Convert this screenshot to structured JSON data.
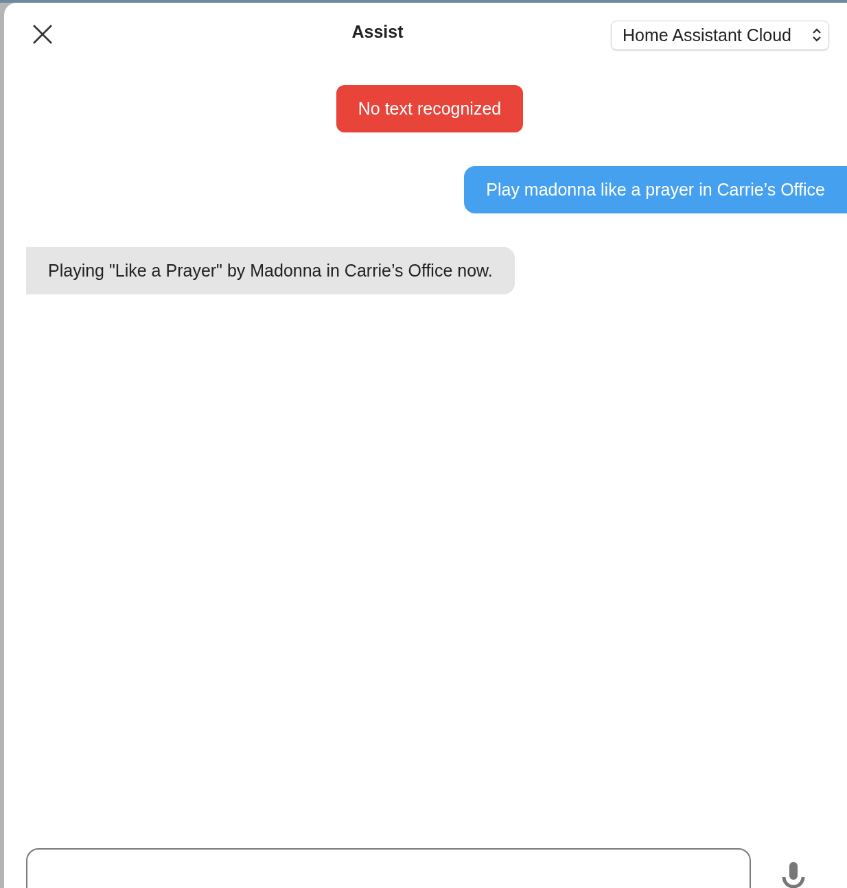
{
  "dialog": {
    "title": "Assist",
    "pipeline": {
      "value": "Home Assistant Cloud"
    }
  },
  "messages": [
    {
      "kind": "error",
      "text": "No text recognized"
    },
    {
      "kind": "user",
      "text": "Play madonna like a prayer in Carrie’s Office"
    },
    {
      "kind": "assistant",
      "text": "Playing \"Like a Prayer\" by Madonna in Carrie’s Office now."
    }
  ],
  "input": {
    "kind": "text"
  }
}
